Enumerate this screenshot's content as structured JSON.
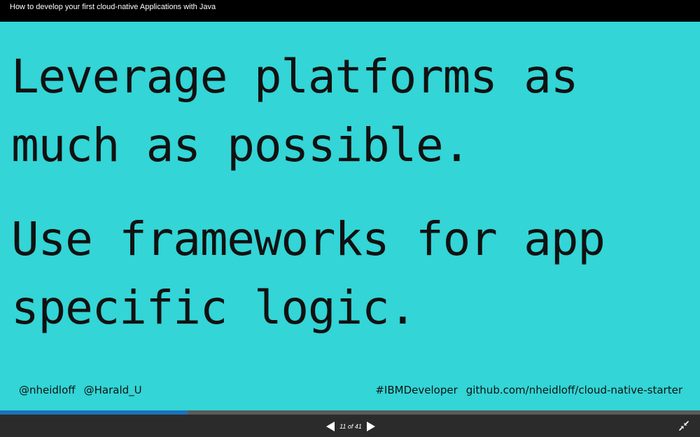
{
  "window": {
    "title": "How to develop your first cloud-native Applications with Java"
  },
  "slide": {
    "lines": [
      "Leverage platforms as",
      "much as possible.",
      "Use frameworks for app",
      "specific logic."
    ],
    "background_color": "#33d5d6",
    "footer_left": [
      "@nheidloff",
      "@Harald_U"
    ],
    "footer_right": [
      "#IBMDeveloper",
      "github.com/nheidloff/cloud-native-starter"
    ]
  },
  "player": {
    "counter_text": "11 of 41",
    "current_slide": 11,
    "total_slides": 41,
    "progress_fraction": 0.268,
    "progress_color": "#1d73b9",
    "icons": {
      "prev": "triangle-left-icon",
      "next": "triangle-right-icon",
      "fullscreen": "collapse-fullscreen-icon"
    }
  }
}
